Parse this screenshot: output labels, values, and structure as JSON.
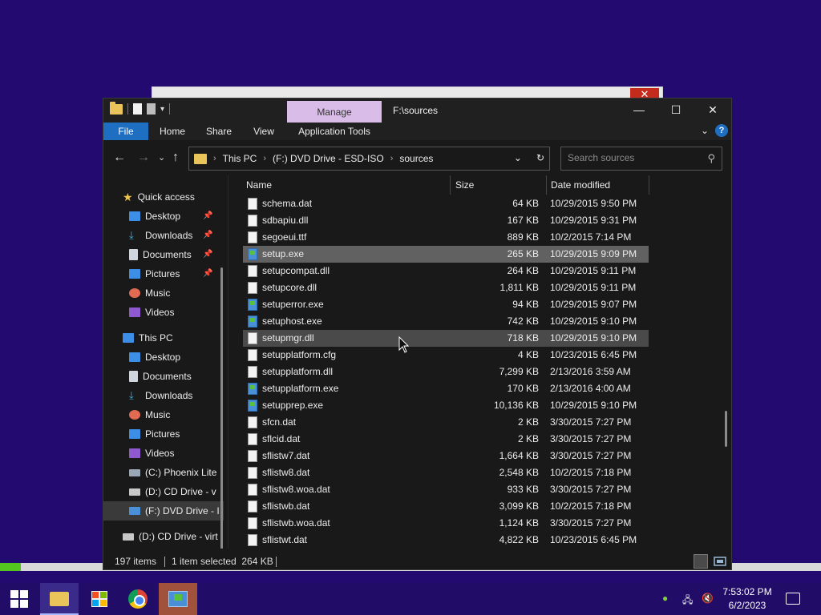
{
  "explorer": {
    "title": "F:\\sources",
    "manage_tab": "Manage",
    "ribbon": {
      "file": "File",
      "home": "Home",
      "share": "Share",
      "view": "View",
      "application_tools": "Application Tools"
    },
    "address": {
      "crumbs": [
        "This PC",
        "(F:) DVD Drive - ESD-ISO",
        "sources"
      ]
    },
    "search": {
      "placeholder": "Search sources"
    },
    "nav": {
      "quick_access": "Quick access",
      "qa_items": [
        "Desktop",
        "Downloads",
        "Documents",
        "Pictures",
        "Music",
        "Videos"
      ],
      "this_pc": "This PC",
      "pc_items": [
        "Desktop",
        "Documents",
        "Downloads",
        "Music",
        "Pictures",
        "Videos",
        "(C:) Phoenix Lite",
        "(D:) CD Drive - v",
        "(F:) DVD Drive - I"
      ],
      "extra_drive": "(D:) CD Drive - virt"
    },
    "columns": {
      "name": "Name",
      "size": "Size",
      "date": "Date modified"
    },
    "files": [
      {
        "name": "schema.dat",
        "size": "64 KB",
        "date": "10/29/2015 9:50 PM",
        "type": "file"
      },
      {
        "name": "sdbapiu.dll",
        "size": "167 KB",
        "date": "10/29/2015 9:31 PM",
        "type": "file"
      },
      {
        "name": "segoeui.ttf",
        "size": "889 KB",
        "date": "10/2/2015 7:14 PM",
        "type": "font"
      },
      {
        "name": "setup.exe",
        "size": "265 KB",
        "date": "10/29/2015 9:09 PM",
        "type": "exe"
      },
      {
        "name": "setupcompat.dll",
        "size": "264 KB",
        "date": "10/29/2015 9:11 PM",
        "type": "file"
      },
      {
        "name": "setupcore.dll",
        "size": "1,811 KB",
        "date": "10/29/2015 9:11 PM",
        "type": "file"
      },
      {
        "name": "setuperror.exe",
        "size": "94 KB",
        "date": "10/29/2015 9:07 PM",
        "type": "exe"
      },
      {
        "name": "setuphost.exe",
        "size": "742 KB",
        "date": "10/29/2015 9:10 PM",
        "type": "exe"
      },
      {
        "name": "setupmgr.dll",
        "size": "718 KB",
        "date": "10/29/2015 9:10 PM",
        "type": "file"
      },
      {
        "name": "setupplatform.cfg",
        "size": "4 KB",
        "date": "10/23/2015 6:45 PM",
        "type": "file"
      },
      {
        "name": "setupplatform.dll",
        "size": "7,299 KB",
        "date": "2/13/2016 3:59 AM",
        "type": "file"
      },
      {
        "name": "setupplatform.exe",
        "size": "170 KB",
        "date": "2/13/2016 4:00 AM",
        "type": "exe"
      },
      {
        "name": "setupprep.exe",
        "size": "10,136 KB",
        "date": "10/29/2015 9:10 PM",
        "type": "exe"
      },
      {
        "name": "sfcn.dat",
        "size": "2 KB",
        "date": "3/30/2015 7:27 PM",
        "type": "file"
      },
      {
        "name": "sflcid.dat",
        "size": "2 KB",
        "date": "3/30/2015 7:27 PM",
        "type": "file"
      },
      {
        "name": "sflistw7.dat",
        "size": "1,664 KB",
        "date": "3/30/2015 7:27 PM",
        "type": "file"
      },
      {
        "name": "sflistw8.dat",
        "size": "2,548 KB",
        "date": "10/2/2015 7:18 PM",
        "type": "file"
      },
      {
        "name": "sflistw8.woa.dat",
        "size": "933 KB",
        "date": "3/30/2015 7:27 PM",
        "type": "file"
      },
      {
        "name": "sflistwb.dat",
        "size": "3,099 KB",
        "date": "10/2/2015 7:18 PM",
        "type": "file"
      },
      {
        "name": "sflistwb.woa.dat",
        "size": "1,124 KB",
        "date": "3/30/2015 7:27 PM",
        "type": "file"
      },
      {
        "name": "sflistwt.dat",
        "size": "4,822 KB",
        "date": "10/23/2015 6:45 PM",
        "type": "file"
      }
    ],
    "selected_index": 3,
    "hover_index": 8,
    "status": {
      "item_count": "197 items",
      "selection": "1 item selected  264 KB"
    }
  },
  "taskbar": {
    "time": "7:53:02 PM",
    "date": "6/2/2023"
  },
  "colors": {
    "desktop": "#220a70",
    "accent": "#1e6fc1",
    "manage_tab": "#d9bde8"
  }
}
